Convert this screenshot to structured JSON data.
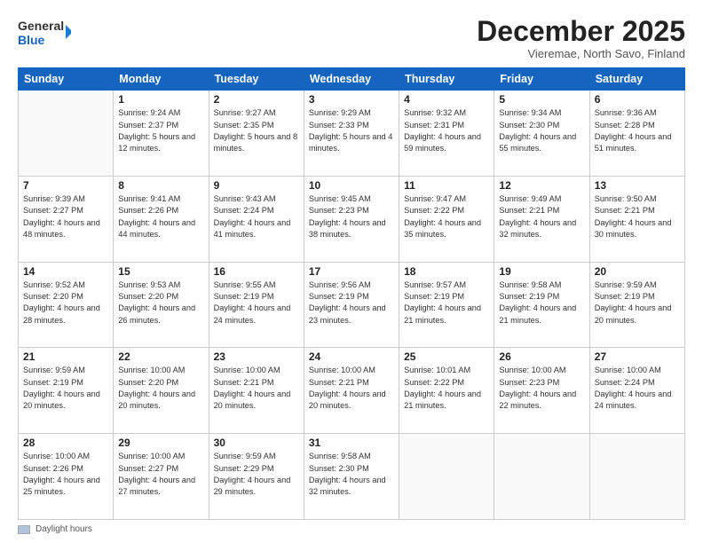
{
  "logo": {
    "line1": "General",
    "line2": "Blue"
  },
  "title": "December 2025",
  "subtitle": "Vieremae, North Savo, Finland",
  "days_header": [
    "Sunday",
    "Monday",
    "Tuesday",
    "Wednesday",
    "Thursday",
    "Friday",
    "Saturday"
  ],
  "weeks": [
    [
      {
        "day": "",
        "info": ""
      },
      {
        "day": "1",
        "info": "Sunrise: 9:24 AM\nSunset: 2:37 PM\nDaylight: 5 hours\nand 12 minutes."
      },
      {
        "day": "2",
        "info": "Sunrise: 9:27 AM\nSunset: 2:35 PM\nDaylight: 5 hours\nand 8 minutes."
      },
      {
        "day": "3",
        "info": "Sunrise: 9:29 AM\nSunset: 2:33 PM\nDaylight: 5 hours\nand 4 minutes."
      },
      {
        "day": "4",
        "info": "Sunrise: 9:32 AM\nSunset: 2:31 PM\nDaylight: 4 hours\nand 59 minutes."
      },
      {
        "day": "5",
        "info": "Sunrise: 9:34 AM\nSunset: 2:30 PM\nDaylight: 4 hours\nand 55 minutes."
      },
      {
        "day": "6",
        "info": "Sunrise: 9:36 AM\nSunset: 2:28 PM\nDaylight: 4 hours\nand 51 minutes."
      }
    ],
    [
      {
        "day": "7",
        "info": "Sunrise: 9:39 AM\nSunset: 2:27 PM\nDaylight: 4 hours\nand 48 minutes."
      },
      {
        "day": "8",
        "info": "Sunrise: 9:41 AM\nSunset: 2:26 PM\nDaylight: 4 hours\nand 44 minutes."
      },
      {
        "day": "9",
        "info": "Sunrise: 9:43 AM\nSunset: 2:24 PM\nDaylight: 4 hours\nand 41 minutes."
      },
      {
        "day": "10",
        "info": "Sunrise: 9:45 AM\nSunset: 2:23 PM\nDaylight: 4 hours\nand 38 minutes."
      },
      {
        "day": "11",
        "info": "Sunrise: 9:47 AM\nSunset: 2:22 PM\nDaylight: 4 hours\nand 35 minutes."
      },
      {
        "day": "12",
        "info": "Sunrise: 9:49 AM\nSunset: 2:21 PM\nDaylight: 4 hours\nand 32 minutes."
      },
      {
        "day": "13",
        "info": "Sunrise: 9:50 AM\nSunset: 2:21 PM\nDaylight: 4 hours\nand 30 minutes."
      }
    ],
    [
      {
        "day": "14",
        "info": "Sunrise: 9:52 AM\nSunset: 2:20 PM\nDaylight: 4 hours\nand 28 minutes."
      },
      {
        "day": "15",
        "info": "Sunrise: 9:53 AM\nSunset: 2:20 PM\nDaylight: 4 hours\nand 26 minutes."
      },
      {
        "day": "16",
        "info": "Sunrise: 9:55 AM\nSunset: 2:19 PM\nDaylight: 4 hours\nand 24 minutes."
      },
      {
        "day": "17",
        "info": "Sunrise: 9:56 AM\nSunset: 2:19 PM\nDaylight: 4 hours\nand 23 minutes."
      },
      {
        "day": "18",
        "info": "Sunrise: 9:57 AM\nSunset: 2:19 PM\nDaylight: 4 hours\nand 21 minutes."
      },
      {
        "day": "19",
        "info": "Sunrise: 9:58 AM\nSunset: 2:19 PM\nDaylight: 4 hours\nand 21 minutes."
      },
      {
        "day": "20",
        "info": "Sunrise: 9:59 AM\nSunset: 2:19 PM\nDaylight: 4 hours\nand 20 minutes."
      }
    ],
    [
      {
        "day": "21",
        "info": "Sunrise: 9:59 AM\nSunset: 2:19 PM\nDaylight: 4 hours\nand 20 minutes."
      },
      {
        "day": "22",
        "info": "Sunrise: 10:00 AM\nSunset: 2:20 PM\nDaylight: 4 hours\nand 20 minutes."
      },
      {
        "day": "23",
        "info": "Sunrise: 10:00 AM\nSunset: 2:21 PM\nDaylight: 4 hours\nand 20 minutes."
      },
      {
        "day": "24",
        "info": "Sunrise: 10:00 AM\nSunset: 2:21 PM\nDaylight: 4 hours\nand 20 minutes."
      },
      {
        "day": "25",
        "info": "Sunrise: 10:01 AM\nSunset: 2:22 PM\nDaylight: 4 hours\nand 21 minutes."
      },
      {
        "day": "26",
        "info": "Sunrise: 10:00 AM\nSunset: 2:23 PM\nDaylight: 4 hours\nand 22 minutes."
      },
      {
        "day": "27",
        "info": "Sunrise: 10:00 AM\nSunset: 2:24 PM\nDaylight: 4 hours\nand 24 minutes."
      }
    ],
    [
      {
        "day": "28",
        "info": "Sunrise: 10:00 AM\nSunset: 2:26 PM\nDaylight: 4 hours\nand 25 minutes."
      },
      {
        "day": "29",
        "info": "Sunrise: 10:00 AM\nSunset: 2:27 PM\nDaylight: 4 hours\nand 27 minutes."
      },
      {
        "day": "30",
        "info": "Sunrise: 9:59 AM\nSunset: 2:29 PM\nDaylight: 4 hours\nand 29 minutes."
      },
      {
        "day": "31",
        "info": "Sunrise: 9:58 AM\nSunset: 2:30 PM\nDaylight: 4 hours\nand 32 minutes."
      },
      {
        "day": "",
        "info": ""
      },
      {
        "day": "",
        "info": ""
      },
      {
        "day": "",
        "info": ""
      }
    ]
  ],
  "footer": {
    "legend_label": "Daylight hours"
  }
}
